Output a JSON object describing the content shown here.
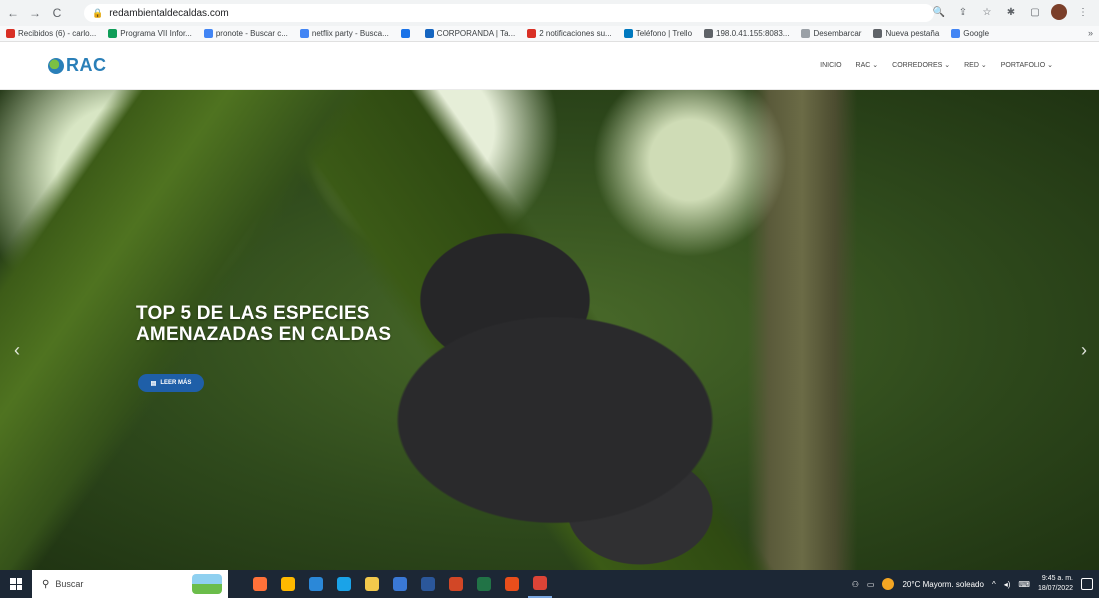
{
  "browser": {
    "url": "redambientaldecaldas.com",
    "nav": {
      "back": "←",
      "forward": "→",
      "reload": "C"
    },
    "right_icons": [
      "zoom-icon",
      "share-icon",
      "star-icon",
      "extensions-icon",
      "sidebar-icon",
      "profile-icon",
      "menu-icon"
    ]
  },
  "bookmarks": {
    "items": [
      {
        "label": "Recibidos (6) - carlo...",
        "color": "#d93025"
      },
      {
        "label": "Programa VII Infor...",
        "color": "#0f9d58"
      },
      {
        "label": "pronote - Buscar c...",
        "color": "#4285f4"
      },
      {
        "label": "netflix party - Busca...",
        "color": "#4285f4"
      },
      {
        "label": "",
        "color": "#1a73e8"
      },
      {
        "label": "CORPORANDA | Ta...",
        "color": "#1565c0"
      },
      {
        "label": "2 notificaciones su...",
        "color": "#d93025"
      },
      {
        "label": "Teléfono | Trello",
        "color": "#0079bf"
      },
      {
        "label": "198.0.41.155:8083...",
        "color": "#5f6368"
      },
      {
        "label": "Desembarcar",
        "color": "#9aa0a6"
      },
      {
        "label": "Nueva pestaña",
        "color": "#5f6368"
      },
      {
        "label": "Google",
        "color": "#4285f4"
      }
    ],
    "more": "»"
  },
  "site": {
    "logo_text": "RAC",
    "nav": [
      "INICIO",
      "RAC ⌄",
      "CORREDORES ⌄",
      "RED ⌄",
      "PORTAFOLIO ⌄"
    ]
  },
  "hero": {
    "title": "TOP 5 DE LAS ESPECIES AMENAZADAS EN CALDAS",
    "button_label": "LEER MÁS",
    "prev": "‹",
    "next": "›"
  },
  "taskbar": {
    "search_placeholder": "Buscar",
    "apps": [
      {
        "name": "firefox-icon",
        "color": "#ff7139"
      },
      {
        "name": "calendar-icon",
        "color": "#ffb900"
      },
      {
        "name": "store-icon",
        "color": "#2b88d8"
      },
      {
        "name": "edge-icon",
        "color": "#1aa3e8"
      },
      {
        "name": "files-icon",
        "color": "#f2c94c"
      },
      {
        "name": "mail-icon",
        "color": "#3a78d4"
      },
      {
        "name": "word-icon",
        "color": "#2b579a"
      },
      {
        "name": "powerpoint-icon",
        "color": "#d24726"
      },
      {
        "name": "excel-icon",
        "color": "#217346"
      },
      {
        "name": "app-icon",
        "color": "#e94e1b"
      },
      {
        "name": "chrome-icon",
        "color": "#db4437"
      }
    ],
    "weather": "20°C Mayorm. soleado",
    "time": "9:45 a. m.",
    "date": "18/07/2022"
  }
}
